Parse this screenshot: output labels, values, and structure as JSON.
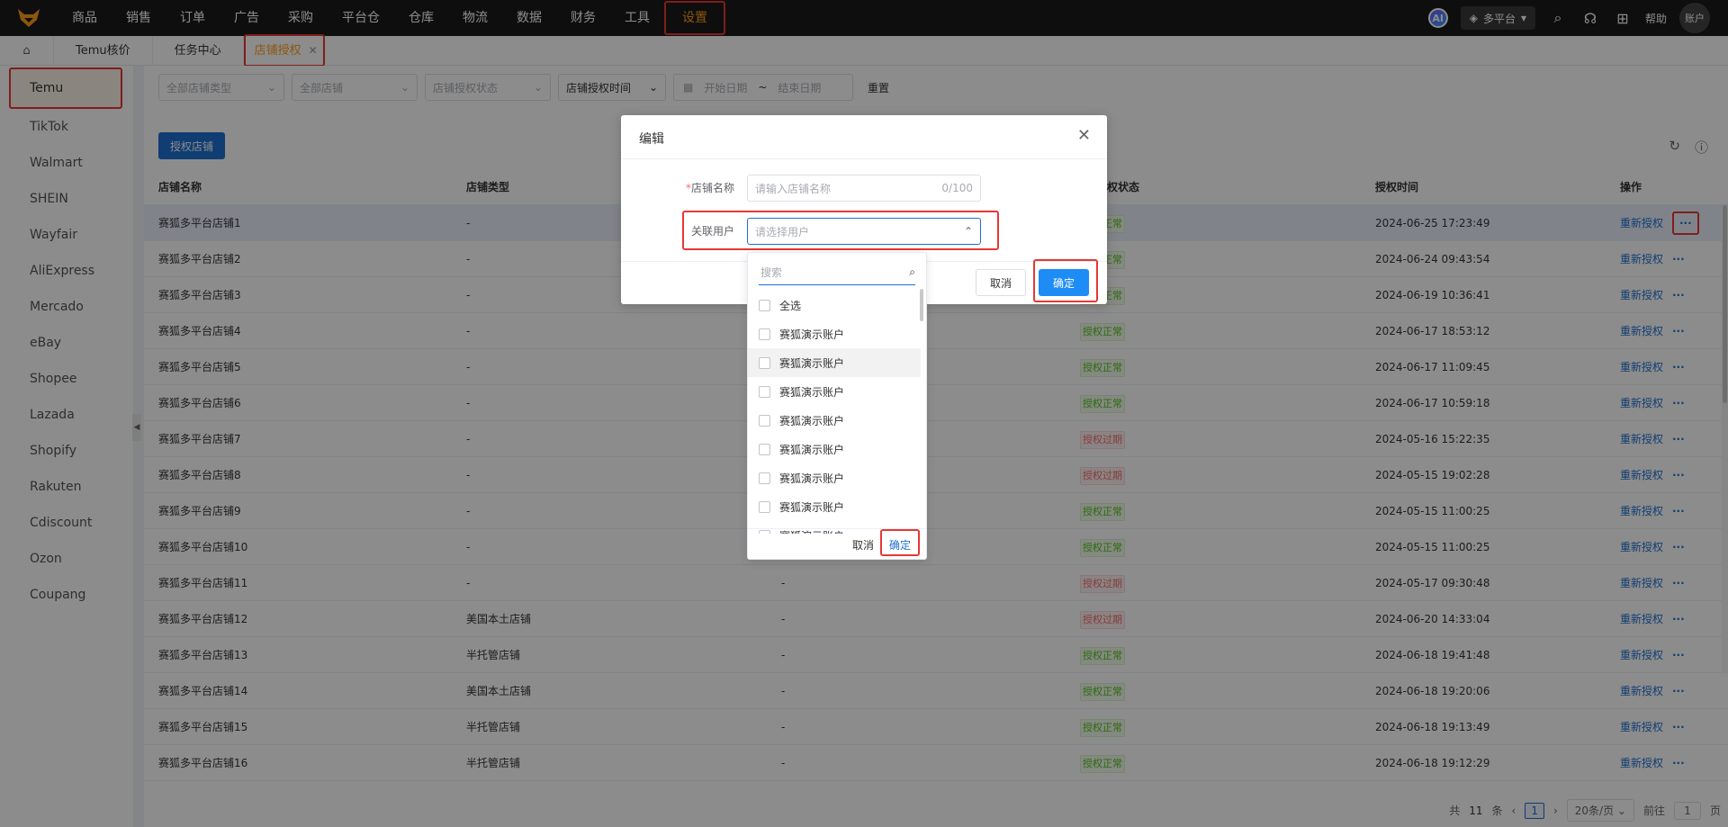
{
  "nav": {
    "items": [
      "商品",
      "销售",
      "订单",
      "广告",
      "采购",
      "平台仓",
      "仓库",
      "物流",
      "数据",
      "财务",
      "工具",
      "设置"
    ],
    "active": "设置",
    "ai_label": "AI",
    "platform_label": "多平台",
    "help_label": "帮助",
    "account_label": "账户"
  },
  "tabs": [
    {
      "label": "Temu核价"
    },
    {
      "label": "任务中心"
    },
    {
      "label": "店铺授权",
      "active": true
    }
  ],
  "sidebar": {
    "items": [
      "Temu",
      "TikTok",
      "Walmart",
      "SHEIN",
      "Wayfair",
      "AliExpress",
      "Mercado",
      "eBay",
      "Shopee",
      "Lazada",
      "Shopify",
      "Rakuten",
      "Cdiscount",
      "Ozon",
      "Coupang"
    ],
    "active": "Temu"
  },
  "filters": {
    "store_type": "全部店铺类型",
    "store": "全部店铺",
    "auth_status": "店铺授权状态",
    "auth_time": "店铺授权时间",
    "start_date": "开始日期",
    "range_sep": "~",
    "end_date": "结束日期",
    "reset": "重置"
  },
  "toolbar": {
    "auth_button": "授权店铺"
  },
  "table": {
    "columns": [
      "店铺名称",
      "店铺类型",
      "",
      "授权状态",
      "授权时间",
      "操作"
    ],
    "rows": [
      {
        "name": "赛狐多平台店铺1",
        "type": "-",
        "user": "",
        "status": "授权正常",
        "time": "2024-06-25 17:23:49"
      },
      {
        "name": "赛狐多平台店铺2",
        "type": "-",
        "user": "",
        "status": "授权正常",
        "time": "2024-06-24 09:43:54"
      },
      {
        "name": "赛狐多平台店铺3",
        "type": "-",
        "user": "",
        "status": "授权正常",
        "time": "2024-06-19 10:36:41"
      },
      {
        "name": "赛狐多平台店铺4",
        "type": "-",
        "user": "",
        "status": "授权正常",
        "time": "2024-06-17 18:53:12"
      },
      {
        "name": "赛狐多平台店铺5",
        "type": "-",
        "user": "",
        "status": "授权正常",
        "time": "2024-06-17 11:09:45"
      },
      {
        "name": "赛狐多平台店铺6",
        "type": "-",
        "user": "",
        "status": "授权正常",
        "time": "2024-06-17 10:59:18"
      },
      {
        "name": "赛狐多平台店铺7",
        "type": "-",
        "user": "",
        "status": "授权过期",
        "time": "2024-05-16 15:22:35"
      },
      {
        "name": "赛狐多平台店铺8",
        "type": "-",
        "user": "",
        "status": "授权过期",
        "time": "2024-05-15 19:02:28"
      },
      {
        "name": "赛狐多平台店铺9",
        "type": "-",
        "user": "",
        "status": "授权正常",
        "time": "2024-05-15 11:00:25"
      },
      {
        "name": "赛狐多平台店铺10",
        "type": "-",
        "user": "-",
        "status": "授权正常",
        "time": "2024-05-15 11:00:25"
      },
      {
        "name": "赛狐多平台店铺11",
        "type": "-",
        "user": "-",
        "status": "授权过期",
        "time": "2024-05-17 09:30:48"
      },
      {
        "name": "赛狐多平台店铺12",
        "type": "美国本土店铺",
        "user": "-",
        "status": "授权过期",
        "time": "2024-06-20 14:33:04"
      },
      {
        "name": "赛狐多平台店铺13",
        "type": "半托管店铺",
        "user": "-",
        "status": "授权正常",
        "time": "2024-06-18 19:41:48"
      },
      {
        "name": "赛狐多平台店铺14",
        "type": "美国本土店铺",
        "user": "-",
        "status": "授权正常",
        "time": "2024-06-18 19:20:06"
      },
      {
        "name": "赛狐多平台店铺15",
        "type": "半托管店铺",
        "user": "-",
        "status": "授权正常",
        "time": "2024-06-18 19:13:49"
      },
      {
        "name": "赛狐多平台店铺16",
        "type": "半托管店铺",
        "user": "-",
        "status": "授权正常",
        "time": "2024-06-18 19:12:29"
      }
    ],
    "action_label": "重新授权",
    "more_label": "···"
  },
  "pagination": {
    "total_prefix": "共",
    "total": "11",
    "total_suffix": "条",
    "current_page": "1",
    "page_size": "20条/页",
    "goto_prefix": "前往",
    "goto_value": "1",
    "goto_suffix": "页"
  },
  "dialog": {
    "title": "编辑",
    "store_name_label": "店铺名称",
    "store_name_placeholder": "请输入店铺名称",
    "store_name_count": "0/100",
    "user_label": "关联用户",
    "user_placeholder": "请选择用户",
    "cancel": "取消",
    "confirm": "确定"
  },
  "dropdown": {
    "search_placeholder": "搜索",
    "select_all": "全选",
    "options": [
      "赛狐演示账户",
      "赛狐演示账户",
      "赛狐演示账户",
      "赛狐演示账户",
      "赛狐演示账户",
      "赛狐演示账户",
      "赛狐演示账户",
      "赛狐演示账户"
    ],
    "cancel": "取消",
    "confirm": "确定"
  }
}
